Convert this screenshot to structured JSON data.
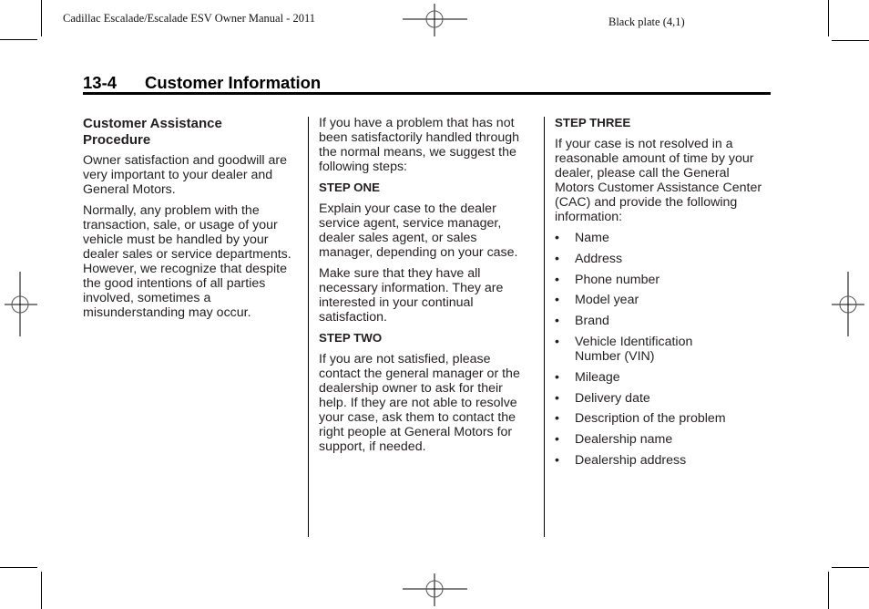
{
  "print_header": {
    "manual_title": "Cadillac Escalade/Escalade ESV Owner Manual - 2011",
    "plate": "Black plate (4,1)"
  },
  "page_header": {
    "page_number": "13-4",
    "section_title": "Customer Information"
  },
  "column1": {
    "heading": "Customer Assistance Procedure",
    "paragraphs": [
      "Owner satisfaction and goodwill are very important to your dealer and General Motors.",
      "Normally, any problem with the transaction, sale, or usage of your vehicle must be handled by your dealer sales or service departments. However, we recognize that despite the good intentions of all parties involved, sometimes a misunderstanding may occur."
    ]
  },
  "column2": {
    "intro": "If you have a problem that has not been satisfactorily handled through the normal means, we suggest the following steps:",
    "step_one": {
      "label": "STEP ONE",
      "paragraphs": [
        "Explain your case to the dealer service agent, service manager, dealer sales agent, or sales manager, depending on your case.",
        "Make sure that they have all necessary information. They are interested in your continual satisfaction."
      ]
    },
    "step_two": {
      "label": "STEP TWO",
      "paragraphs": [
        "If you are not satisfied, please contact the general manager or the dealership owner to ask for their help. If they are not able to resolve your case, ask them to contact the right people at General Motors for support, if needed."
      ]
    }
  },
  "column3": {
    "step_three": {
      "label": "STEP THREE",
      "paragraph": "If your case is not resolved in a reasonable amount of time by your dealer, please call the General Motors Customer Assistance Center (CAC) and provide the following information:"
    },
    "bullet_glyph": "•",
    "bullets": [
      "Name",
      "Address",
      "Phone number",
      "Model year",
      "Brand",
      "Vehicle Identification Number (VIN)",
      "Mileage",
      "Delivery date",
      "Description of the problem",
      "Dealership name",
      "Dealership address"
    ]
  }
}
